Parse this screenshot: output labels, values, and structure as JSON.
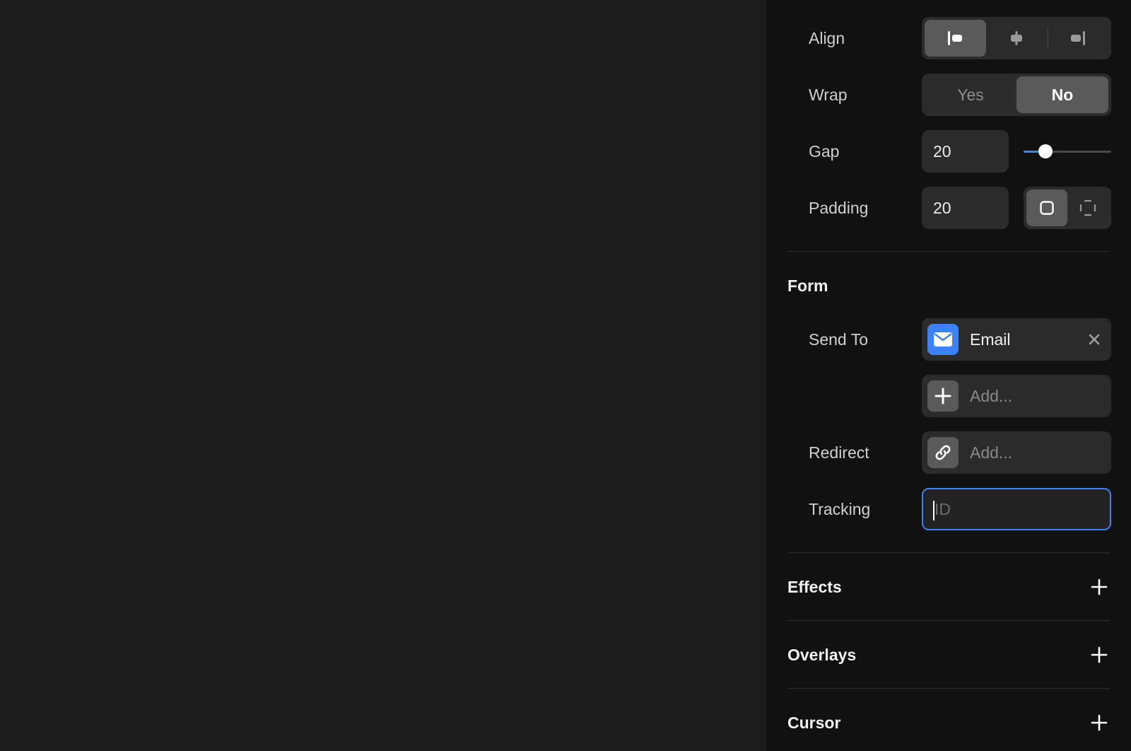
{
  "layout_props": {
    "align": {
      "label": "Align",
      "options": [
        "align-left-icon",
        "align-center-icon",
        "align-right-icon"
      ],
      "selected": 0
    },
    "wrap": {
      "label": "Wrap",
      "options": [
        "Yes",
        "No"
      ],
      "selected": "No"
    },
    "gap": {
      "label": "Gap",
      "value": "20",
      "slider_fraction": 0.25
    },
    "padding": {
      "label": "Padding",
      "value": "20",
      "modes": [
        "padding-uniform-icon",
        "padding-individual-icon"
      ],
      "selected": 0
    }
  },
  "form": {
    "title": "Form",
    "send_to": {
      "label": "Send To",
      "item": "Email",
      "add_placeholder": "Add..."
    },
    "redirect": {
      "label": "Redirect",
      "placeholder": "Add..."
    },
    "tracking": {
      "label": "Tracking",
      "placeholder": "ID"
    }
  },
  "sections": {
    "effects": "Effects",
    "overlays": "Overlays",
    "cursor": "Cursor"
  },
  "colors": {
    "accent": "#3b82f6",
    "panel_bg": "#111111",
    "canvas_bg": "#1c1c1c"
  }
}
